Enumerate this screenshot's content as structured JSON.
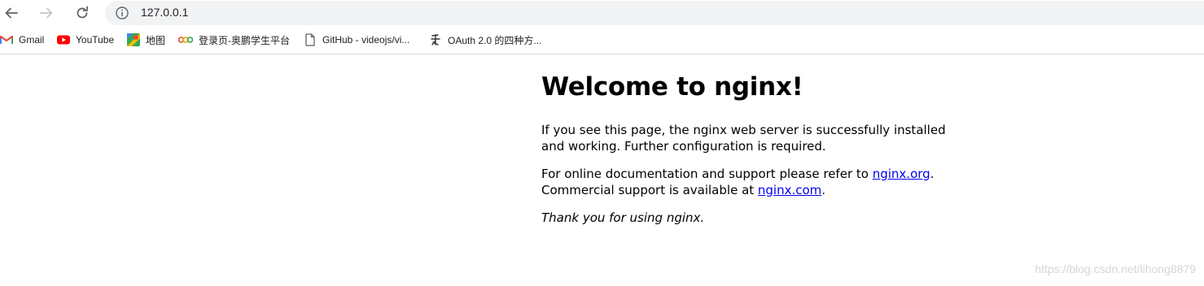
{
  "browser": {
    "url": "127.0.0.1",
    "icons": {
      "back": "back-arrow-icon",
      "forward": "forward-arrow-icon",
      "reload": "reload-icon",
      "site_info": "info-circle-icon"
    }
  },
  "bookmarks": [
    {
      "label": "Gmail",
      "icon": "gmail-icon"
    },
    {
      "label": "YouTube",
      "icon": "youtube-icon"
    },
    {
      "label": "地图",
      "icon": "maps-icon"
    },
    {
      "label": "登录页-奥鹏学生平台",
      "icon": "aopeng-icon"
    },
    {
      "label": "GitHub - videojs/vi...",
      "icon": "page-icon"
    },
    {
      "label": "OAuth 2.0 的四种方...",
      "icon": "blog-icon"
    }
  ],
  "page": {
    "heading": "Welcome to nginx!",
    "p1": "If you see this page, the nginx web server is successfully installed and working. Further configuration is required.",
    "p2_before": "For online documentation and support please refer to ",
    "p2_link1": "nginx.org",
    "p2_middle": ".",
    "p2_line2": "Commercial support is available at ",
    "p2_link2": "nginx.com",
    "p2_end": ".",
    "p3": "Thank you for using nginx."
  },
  "watermark": "https://blog.csdn.net/lihong8879",
  "colors": {
    "link": "#0000ee",
    "omnibox_bg": "#f1f3f4",
    "youtube_red": "#ff0000",
    "gmail_red": "#ea4335"
  }
}
